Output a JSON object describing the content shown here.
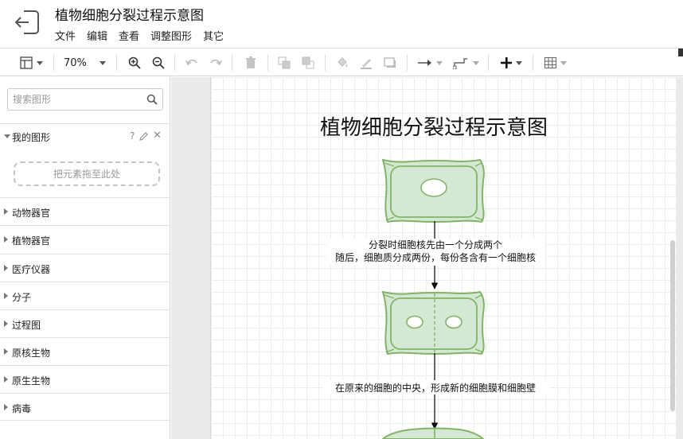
{
  "header": {
    "title": "植物细胞分裂过程示意图",
    "menus": [
      "文件",
      "编辑",
      "查看",
      "调整图形",
      "其它"
    ]
  },
  "toolbar": {
    "zoom": "70%",
    "icons": [
      "format-panel-icon",
      "zoom-in-icon",
      "zoom-out-icon",
      "undo-icon",
      "redo-icon",
      "delete-icon",
      "to-front-icon",
      "to-back-icon",
      "fill-color-icon",
      "line-color-icon",
      "shadow-icon",
      "connection-arrow-icon",
      "waypoint-icon",
      "insert-plus-icon",
      "table-icon"
    ]
  },
  "sidebar": {
    "search_placeholder": "搜索图形",
    "my_shapes": {
      "title": "我的图形",
      "help": "?",
      "close": "✕",
      "drop_hint": "把元素拖至此处"
    },
    "categories": [
      "动物器官",
      "植物器官",
      "医疗仪器",
      "分子",
      "过程图",
      "原核生物",
      "原生生物",
      "病毒"
    ]
  },
  "splitter_glyph": "‖",
  "diagram": {
    "title": "植物细胞分裂过程示意图",
    "label1_line1": "分裂时细胞核先由一个分成两个",
    "label1_line2": "随后，细胞质分成两份，每份各含有一个细胞核",
    "label2": "在原来的细胞的中央，形成新的细胞膜和细胞壁",
    "colors": {
      "cell_fill": "#d5e8d4",
      "cell_stroke": "#82b366",
      "arrow": "#000000"
    }
  }
}
